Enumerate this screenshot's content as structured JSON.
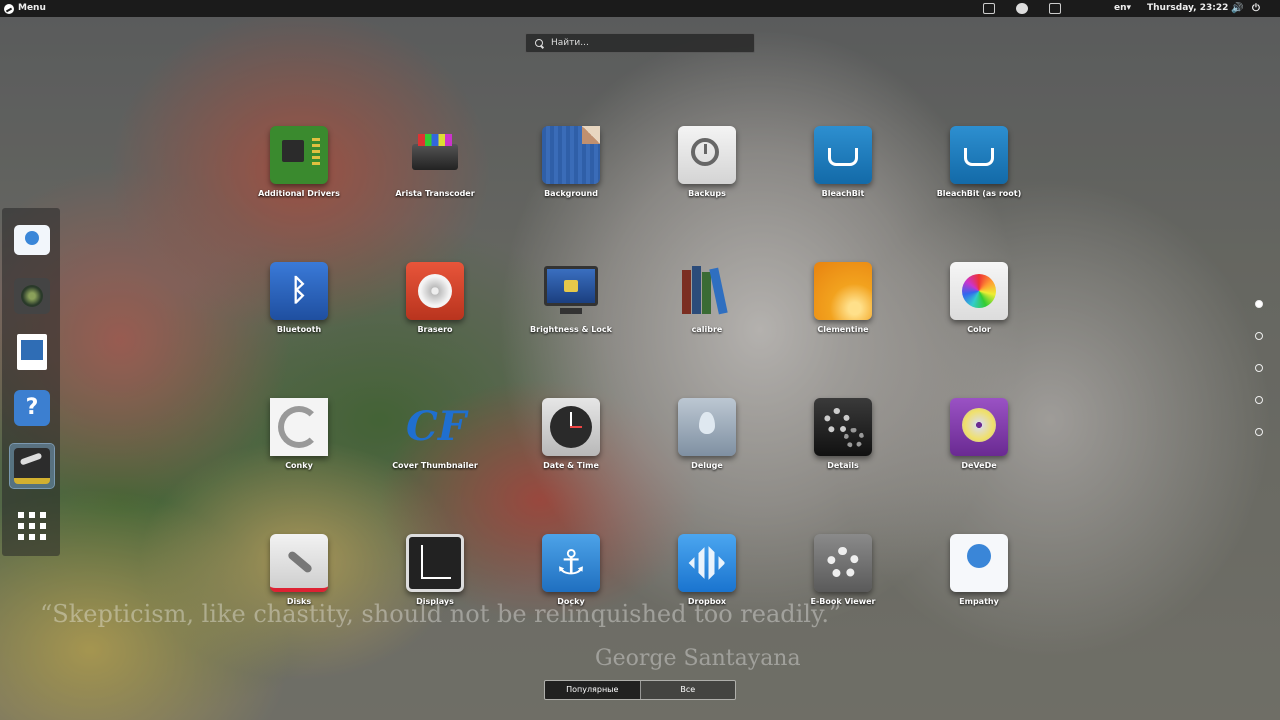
{
  "top_panel": {
    "menu_label": "Menu",
    "language": "en▾",
    "clock": "Thursday, 23:22"
  },
  "search": {
    "placeholder": "Найти..."
  },
  "dock": {
    "items": [
      "empathy-icon",
      "camera-icon",
      "writer-icon",
      "help-icon",
      "steam-icon",
      "apps-grid-icon"
    ]
  },
  "apps": [
    {
      "label": "Additional Drivers",
      "icon": "chip-icon"
    },
    {
      "label": "Arista Transcoder",
      "icon": "transcoder-icon"
    },
    {
      "label": "Background",
      "icon": "wallpaper-icon"
    },
    {
      "label": "Backups",
      "icon": "clock-backup-icon"
    },
    {
      "label": "BleachBit",
      "icon": "bleachbit-icon"
    },
    {
      "label": "BleachBit (as root)",
      "icon": "bleachbit-icon"
    },
    {
      "label": "Bluetooth",
      "icon": "bluetooth-icon"
    },
    {
      "label": "Brasero",
      "icon": "disc-icon"
    },
    {
      "label": "Brightness & Lock",
      "icon": "monitor-lock-icon"
    },
    {
      "label": "calibre",
      "icon": "books-icon"
    },
    {
      "label": "Clementine",
      "icon": "orange-icon"
    },
    {
      "label": "Color",
      "icon": "color-wheel-icon"
    },
    {
      "label": "Conky",
      "icon": "conky-icon"
    },
    {
      "label": "Cover Thumbnailer",
      "icon": "cf-icon"
    },
    {
      "label": "Date & Time",
      "icon": "clock-icon"
    },
    {
      "label": "Deluge",
      "icon": "drop-icon"
    },
    {
      "label": "Details",
      "icon": "gears-icon"
    },
    {
      "label": "DeVeDe",
      "icon": "dvd-icon"
    },
    {
      "label": "Disks",
      "icon": "wrench-icon"
    },
    {
      "label": "Displays",
      "icon": "display-axes-icon"
    },
    {
      "label": "Docky",
      "icon": "anchor-icon"
    },
    {
      "label": "Dropbox",
      "icon": "dropbox-icon"
    },
    {
      "label": "E-Book Viewer",
      "icon": "gear-icon"
    },
    {
      "label": "Empathy",
      "icon": "chat-smile-icon"
    }
  ],
  "quote": {
    "text": "“Skepticism, like chastity, should not be relinquished too readily.”",
    "author": "George Santayana"
  },
  "tabs": [
    {
      "label": "Популярные"
    },
    {
      "label": "Все"
    }
  ],
  "colors": {
    "panel": "#1b1b1b",
    "accent": "#3c7fd0"
  }
}
